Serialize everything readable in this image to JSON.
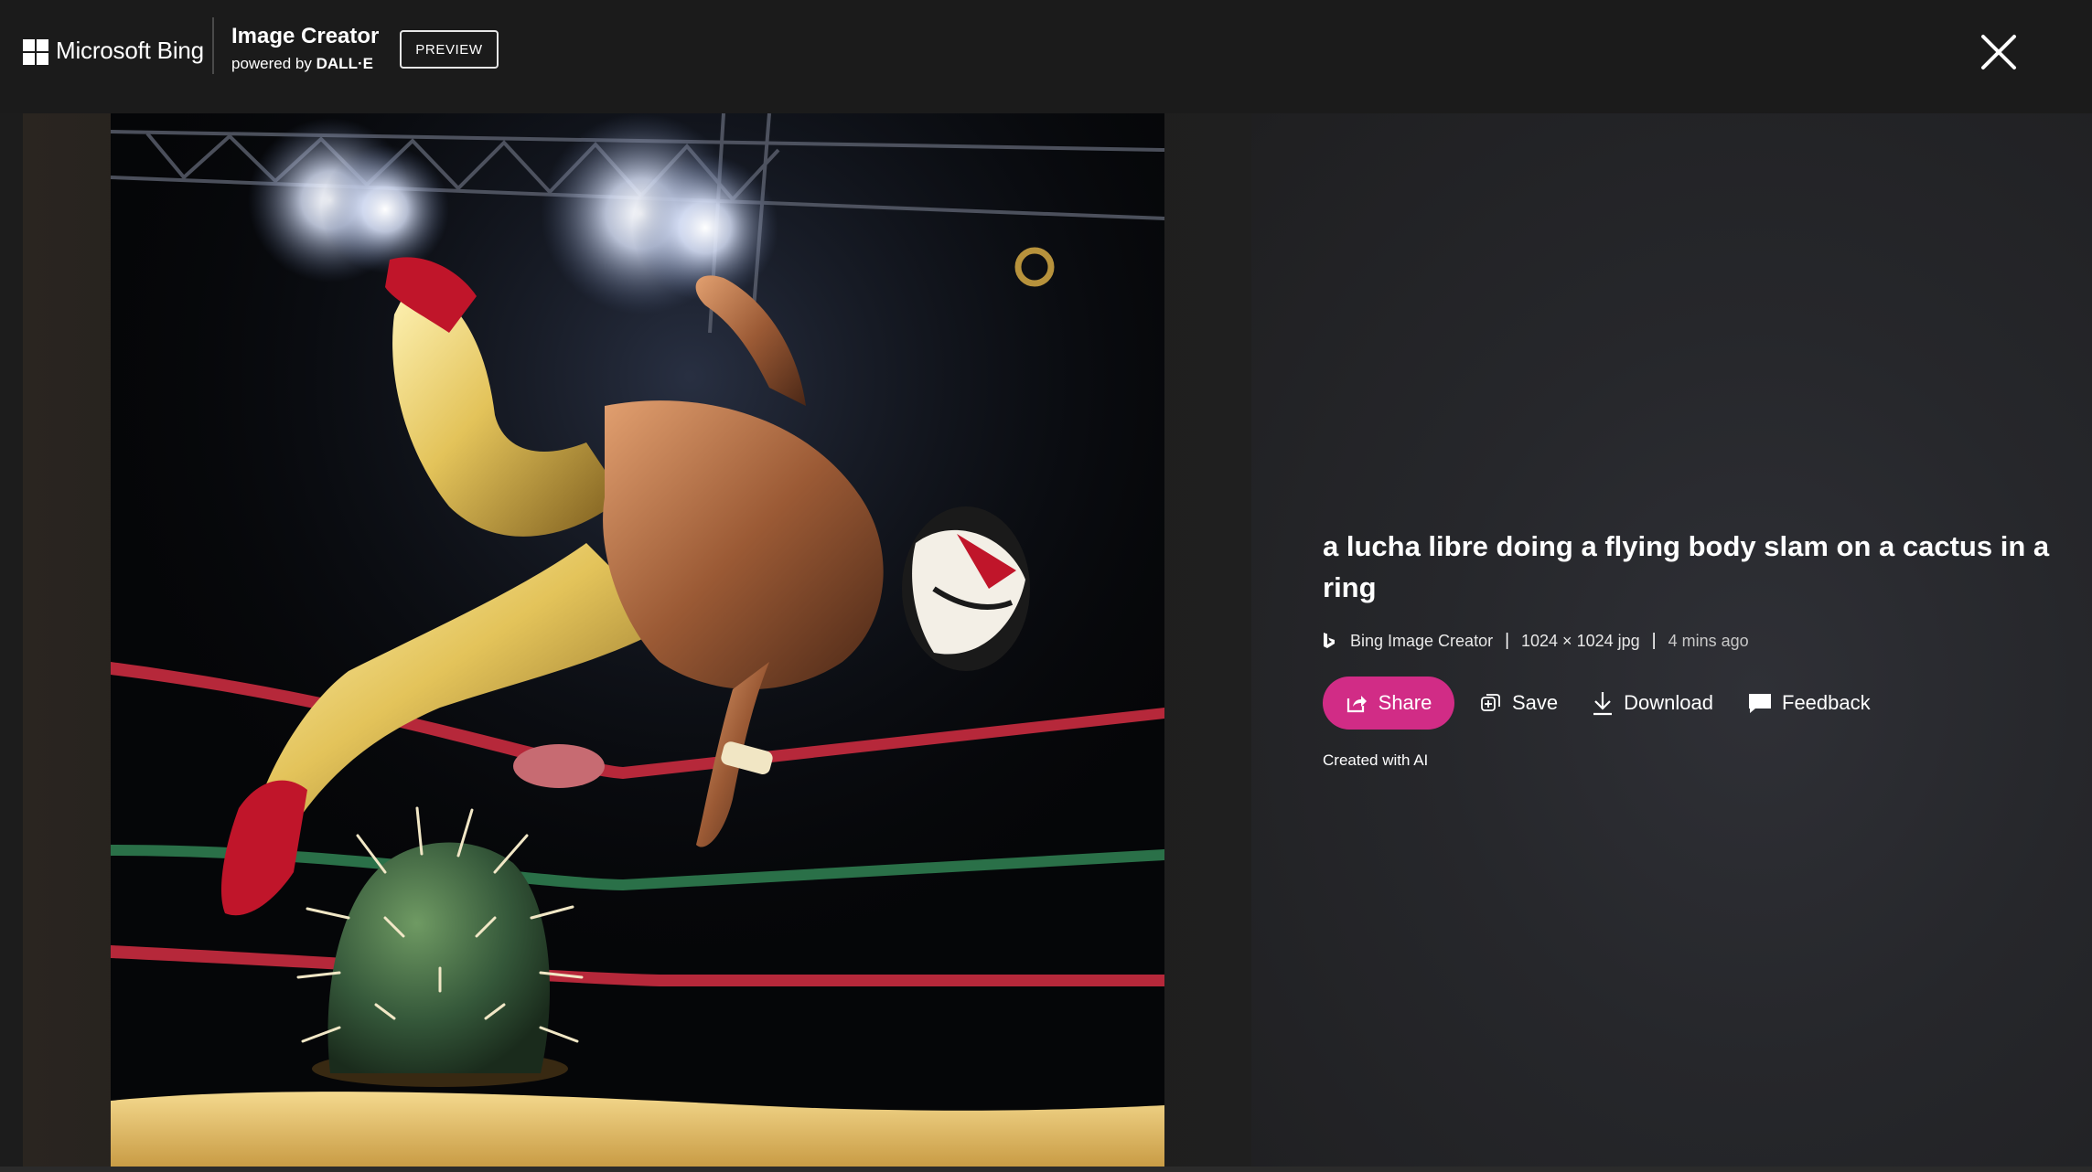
{
  "header": {
    "brand": "Microsoft Bing",
    "product_title": "Image Creator",
    "powered_by_prefix": "powered by ",
    "powered_by_name": "DALL·E",
    "badge": "PREVIEW",
    "close_icon": "close-icon"
  },
  "image": {
    "alt": "a lucha libre doing a flying body slam on a cactus in a ring"
  },
  "details": {
    "title": "a lucha libre doing a flying body slam on a cactus in a ring",
    "source": "Bing Image Creator",
    "separator": "|",
    "dimensions": "1024 × 1024 jpg",
    "time_ago": "4 mins ago",
    "source_icon": "bing-logo-icon",
    "created_note": "Created with AI"
  },
  "actions": {
    "share": "Share",
    "save": "Save",
    "download": "Download",
    "feedback": "Feedback"
  },
  "colors": {
    "accent": "#d12c86",
    "background": "#1b1b1b"
  }
}
